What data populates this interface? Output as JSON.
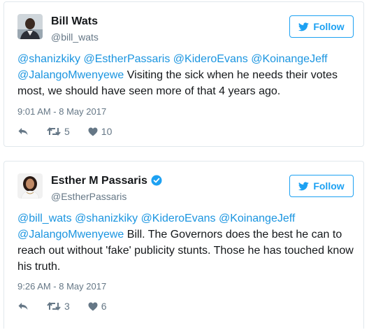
{
  "tweets": [
    {
      "name": "Bill Wats",
      "handle": "@bill_wats",
      "verified": false,
      "follow_label": "Follow",
      "mentions": [
        "@shanizkiky",
        "@EstherPassaris",
        "@KideroEvans",
        "@KoinangeJeff",
        "@JalangoMwenyewe"
      ],
      "body": "Visiting the sick when he needs their votes most, we should have seen more of that 4 years ago.",
      "time": "9:01 AM - 8 May 2017",
      "retweets": "5",
      "likes": "10"
    },
    {
      "name": "Esther M Passaris",
      "handle": "@EstherPassaris",
      "verified": true,
      "follow_label": "Follow",
      "mentions": [
        "@bill_wats",
        "@shanizkiky",
        "@KideroEvans",
        "@KoinangeJeff",
        "@JalangoMwenyewe"
      ],
      "body": "Bill. The Governors does the best he can to reach out without 'fake' publicity stunts. Those he has touched know his truth.",
      "time": "9:26 AM - 8 May 2017",
      "retweets": "3",
      "likes": "6"
    }
  ],
  "icons": {
    "twitter": "twitter-bird-icon",
    "verified": "verified-badge-icon",
    "reply": "reply-icon",
    "retweet": "retweet-icon",
    "like": "heart-icon"
  },
  "colors": {
    "accent": "#1da1f2",
    "mention": "#1b95e0",
    "muted": "#657786",
    "border": "#e1e8ed"
  }
}
